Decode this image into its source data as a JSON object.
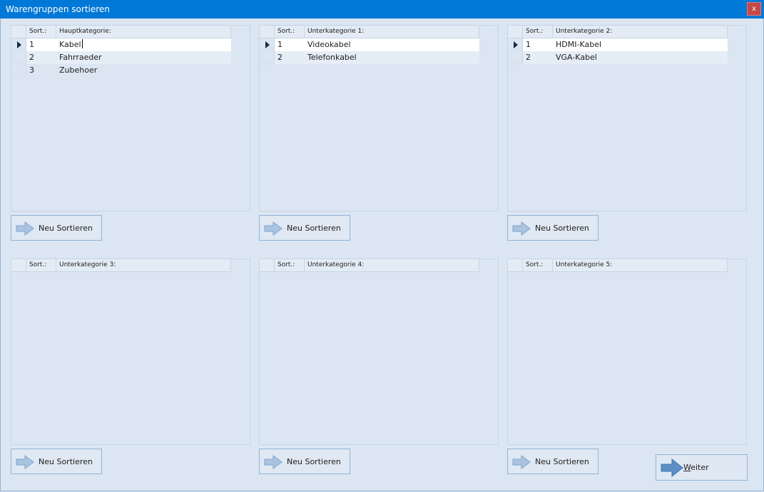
{
  "window": {
    "title": "Warengruppen sortieren",
    "close_label": "x"
  },
  "panels": [
    {
      "col1": "Sort.:",
      "col2": "Hauptkategorie:",
      "rows": [
        {
          "sort": "1",
          "name": "Kabel"
        },
        {
          "sort": "2",
          "name": "Fahrraeder"
        },
        {
          "sort": "3",
          "name": "Zubehoer"
        }
      ]
    },
    {
      "col1": "Sort.:",
      "col2": "Unterkategorie 1:",
      "rows": [
        {
          "sort": "1",
          "name": "Videokabel"
        },
        {
          "sort": "2",
          "name": "Telefonkabel"
        }
      ]
    },
    {
      "col1": "Sort.:",
      "col2": "Unterkategorie 2:",
      "rows": [
        {
          "sort": "1",
          "name": "HDMI-Kabel"
        },
        {
          "sort": "2",
          "name": "VGA-Kabel"
        }
      ]
    },
    {
      "col1": "Sort.:",
      "col2": "Unterkategorie 3:",
      "rows": []
    },
    {
      "col1": "Sort.:",
      "col2": "Unterkategorie 4:",
      "rows": []
    },
    {
      "col1": "Sort.:",
      "col2": "Unterkategorie 5:",
      "rows": []
    }
  ],
  "buttons": {
    "resort_label": "Neu Sortieren",
    "next_label_underlined": "W",
    "next_label_rest": "eiter"
  },
  "colors": {
    "titlebar": "#0078d7",
    "close": "#c74848",
    "background": "#dce6f2",
    "arrow": "#5b8fc5"
  }
}
